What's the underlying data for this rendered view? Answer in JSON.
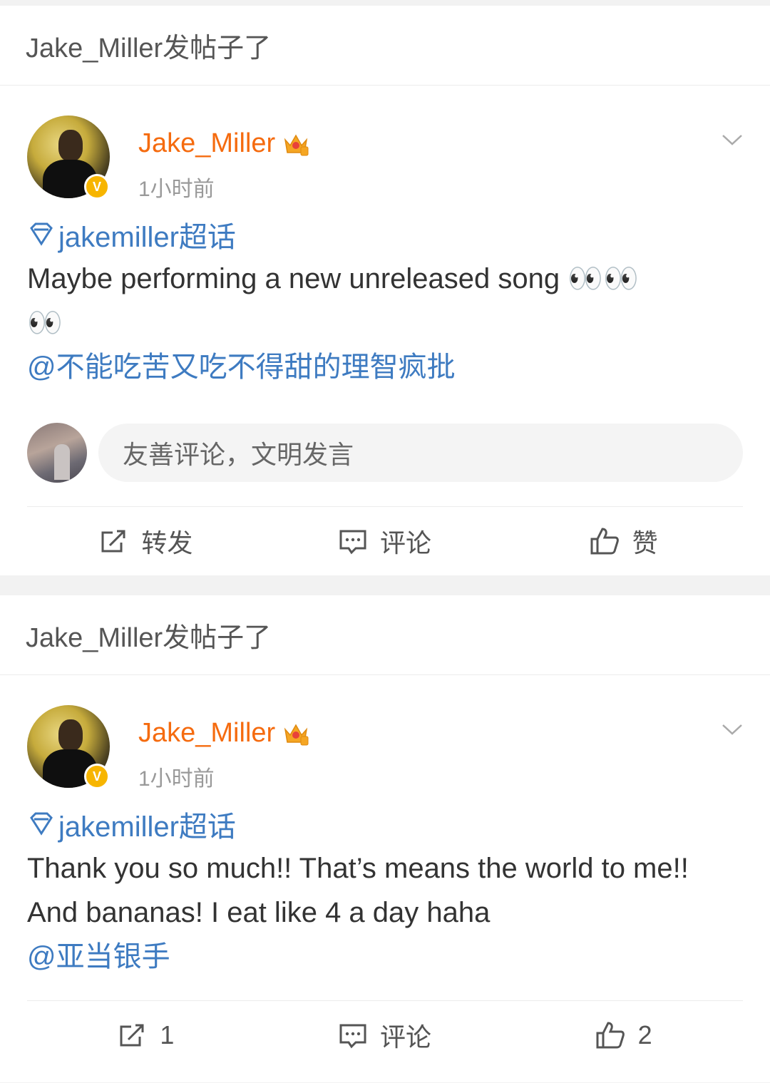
{
  "posts": [
    {
      "header": "Jake_Miller发帖子了",
      "author": "Jake_Miller",
      "badge": "V",
      "time": "1小时前",
      "topic": "jakemiller超话",
      "text": "Maybe performing a new unreleased song 👀👀",
      "text_extra": "👀",
      "mention": "@不能吃苦又吃不得甜的理智疯批",
      "comment_placeholder": "友善评论，文明发言",
      "actions": {
        "repost": "转发",
        "comment": "评论",
        "like": "赞"
      }
    },
    {
      "header": "Jake_Miller发帖子了",
      "author": "Jake_Miller",
      "badge": "V",
      "time": "1小时前",
      "topic": "jakemiller超话",
      "text": "Thank you so much!! That’s means the world to me!! And bananas! I eat like 4 a day haha",
      "mention": "@亚当银手",
      "actions": {
        "repost": "1",
        "comment": "评论",
        "like": "2"
      }
    }
  ],
  "colors": {
    "name": "#f56b0f",
    "link": "#3e7bc1",
    "badge": "#f7b500"
  },
  "icons": [
    "chevron-down-icon",
    "topic-diamond-icon",
    "repost-icon",
    "comment-icon",
    "like-icon",
    "crown-icon"
  ]
}
